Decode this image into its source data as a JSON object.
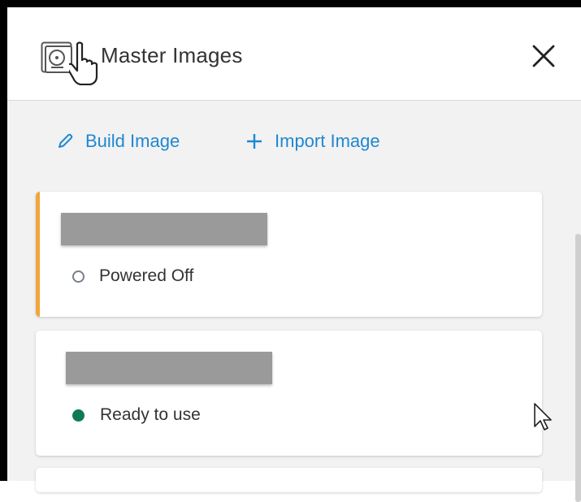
{
  "panel": {
    "title": "Master Images",
    "close_icon": "close-icon",
    "header_icon": "disk-image-icon"
  },
  "toolbar": {
    "build_label": "Build Image",
    "import_label": "Import Image",
    "accent_color": "#1e88d2"
  },
  "images": [
    {
      "name": "",
      "status": "Powered Off",
      "status_color": "#777f88",
      "selected": true,
      "accent_color": "#f0a63c"
    },
    {
      "name": "",
      "status": "Ready to use",
      "status_color": "#0f7a52",
      "selected": false
    }
  ]
}
